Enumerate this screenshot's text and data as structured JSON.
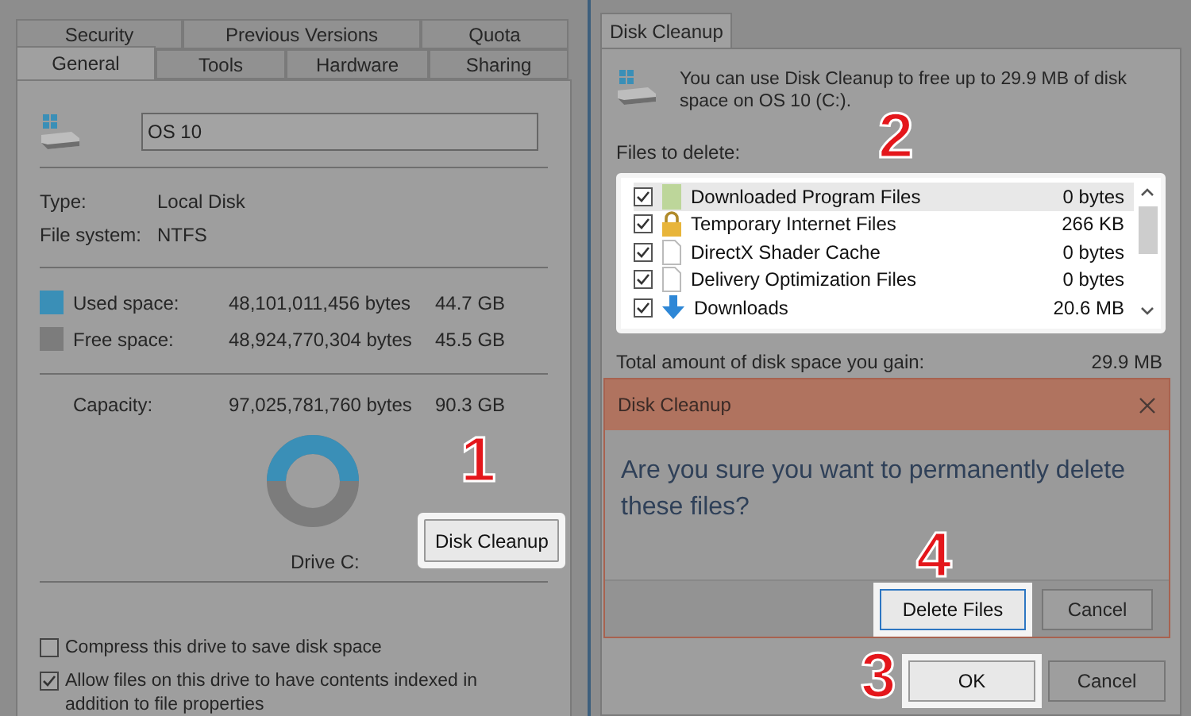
{
  "properties_window": {
    "tab_rows": [
      [
        {
          "label": "Security",
          "selected": false
        },
        {
          "label": "Previous Versions",
          "selected": false
        },
        {
          "label": "Quota",
          "selected": false
        }
      ],
      [
        {
          "label": "General",
          "selected": true
        },
        {
          "label": "Tools",
          "selected": false
        },
        {
          "label": "Hardware",
          "selected": false
        },
        {
          "label": "Sharing",
          "selected": false
        }
      ]
    ],
    "drive_name": "OS 10",
    "info": [
      {
        "label": "Type:",
        "value": "Local Disk"
      },
      {
        "label": "File system:",
        "value": "NTFS"
      }
    ],
    "space": [
      {
        "label": "Used space:",
        "bytes": "48,101,011,456 bytes",
        "size": "44.7 GB",
        "color": "#3a8fb7"
      },
      {
        "label": "Free space:",
        "bytes": "48,924,770,304 bytes",
        "size": "45.5 GB",
        "color": "#7c7c7c"
      }
    ],
    "capacity": {
      "label": "Capacity:",
      "bytes": "97,025,781,760 bytes",
      "size": "90.3 GB"
    },
    "drive_label": "Drive C:",
    "cleanup_button": "Disk Cleanup",
    "options": [
      {
        "label": "Compress this drive to save disk space",
        "checked": false
      },
      {
        "label": "Allow files on this drive to have contents indexed in addition to file properties",
        "checked": true
      }
    ]
  },
  "cleanup_window": {
    "tab": "Disk Cleanup",
    "message": "You can use Disk Cleanup to free up to 29.9 MB of disk space on OS 10 (C:).",
    "files_label": "Files to delete:",
    "files": [
      {
        "name": "Downloaded Program Files",
        "size": "0 bytes",
        "checked": true,
        "selected": true,
        "kind": "folder"
      },
      {
        "name": "Temporary Internet Files",
        "size": "266 KB",
        "checked": true,
        "selected": false,
        "kind": "lock"
      },
      {
        "name": "DirectX Shader Cache",
        "size": "0 bytes",
        "checked": true,
        "selected": false,
        "kind": "file"
      },
      {
        "name": "Delivery Optimization Files",
        "size": "0 bytes",
        "checked": true,
        "selected": false,
        "kind": "file"
      },
      {
        "name": "Downloads",
        "size": "20.6 MB",
        "checked": true,
        "selected": false,
        "kind": "download"
      }
    ],
    "total_label": "Total amount of disk space you gain:",
    "total_value": "29.9 MB",
    "buttons": [
      "OK",
      "Cancel"
    ]
  },
  "confirm_dialog": {
    "title": "Disk Cleanup",
    "message": "Are you sure you want to permanently delete these files?",
    "buttons": [
      "Delete Files",
      "Cancel"
    ]
  },
  "step_markers": [
    "1",
    "2",
    "3",
    "4"
  ]
}
